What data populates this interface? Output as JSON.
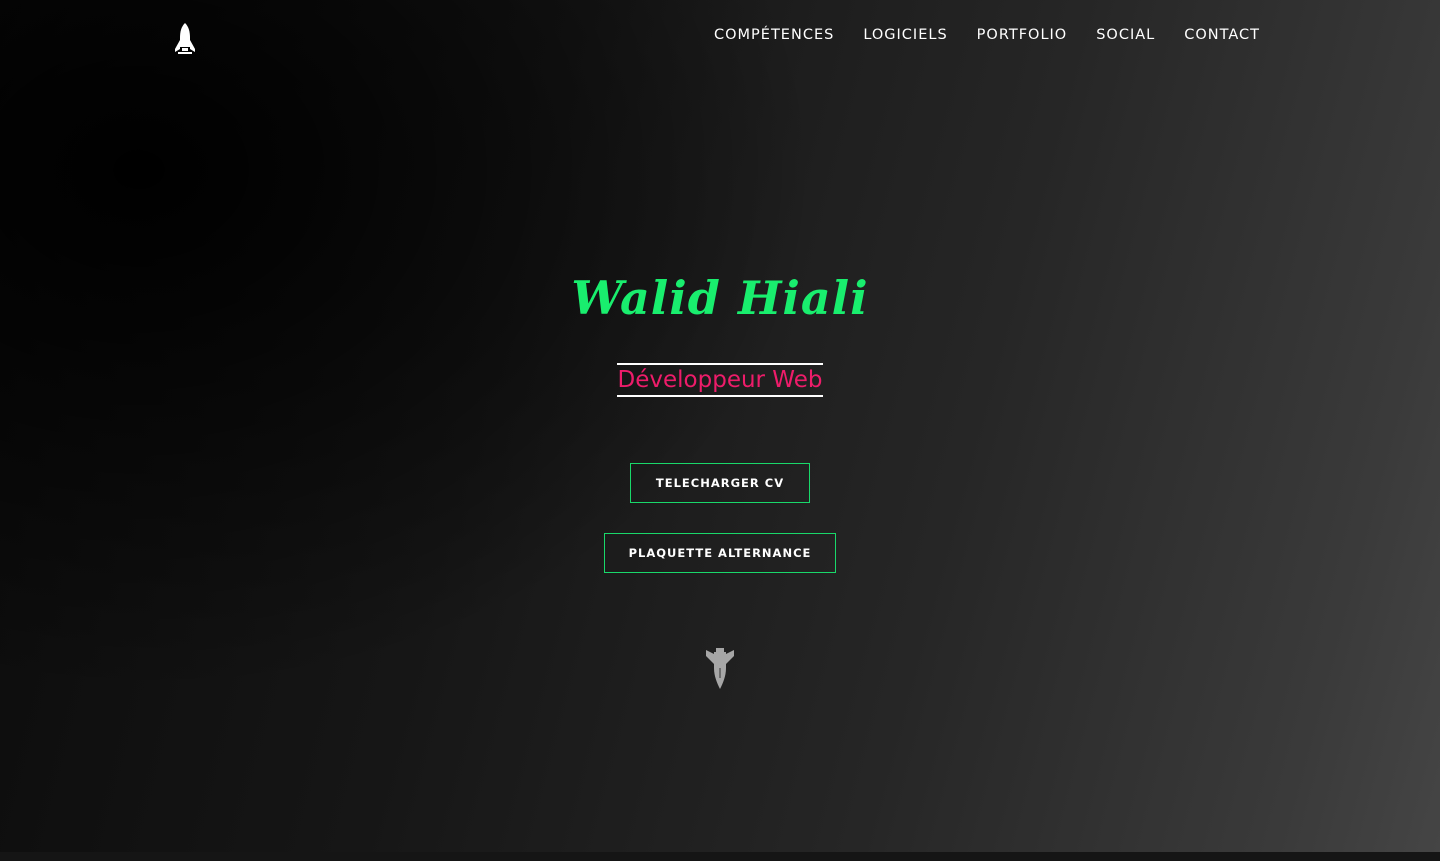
{
  "brand": {
    "logo_icon": "rocket-icon",
    "logo_color": "#ffffff"
  },
  "nav": {
    "items": [
      {
        "label": "COMPÉTENCES"
      },
      {
        "label": "LOGICIELS"
      },
      {
        "label": "PORTFOLIO"
      },
      {
        "label": "SOCIAL"
      },
      {
        "label": "CONTACT"
      }
    ]
  },
  "hero": {
    "name": "Walid Hiali",
    "role": "Développeur Web",
    "buttons": {
      "cv_label": "TELECHARGER CV",
      "plaquette_label": "PLAQUETTE ALTERNANCE"
    },
    "scroll_icon": "rocket-down-icon"
  },
  "colors": {
    "accent_green": "#19ee6e",
    "accent_pink": "#ee1c6a",
    "button_border": "#19d86a",
    "text": "#ffffff"
  }
}
